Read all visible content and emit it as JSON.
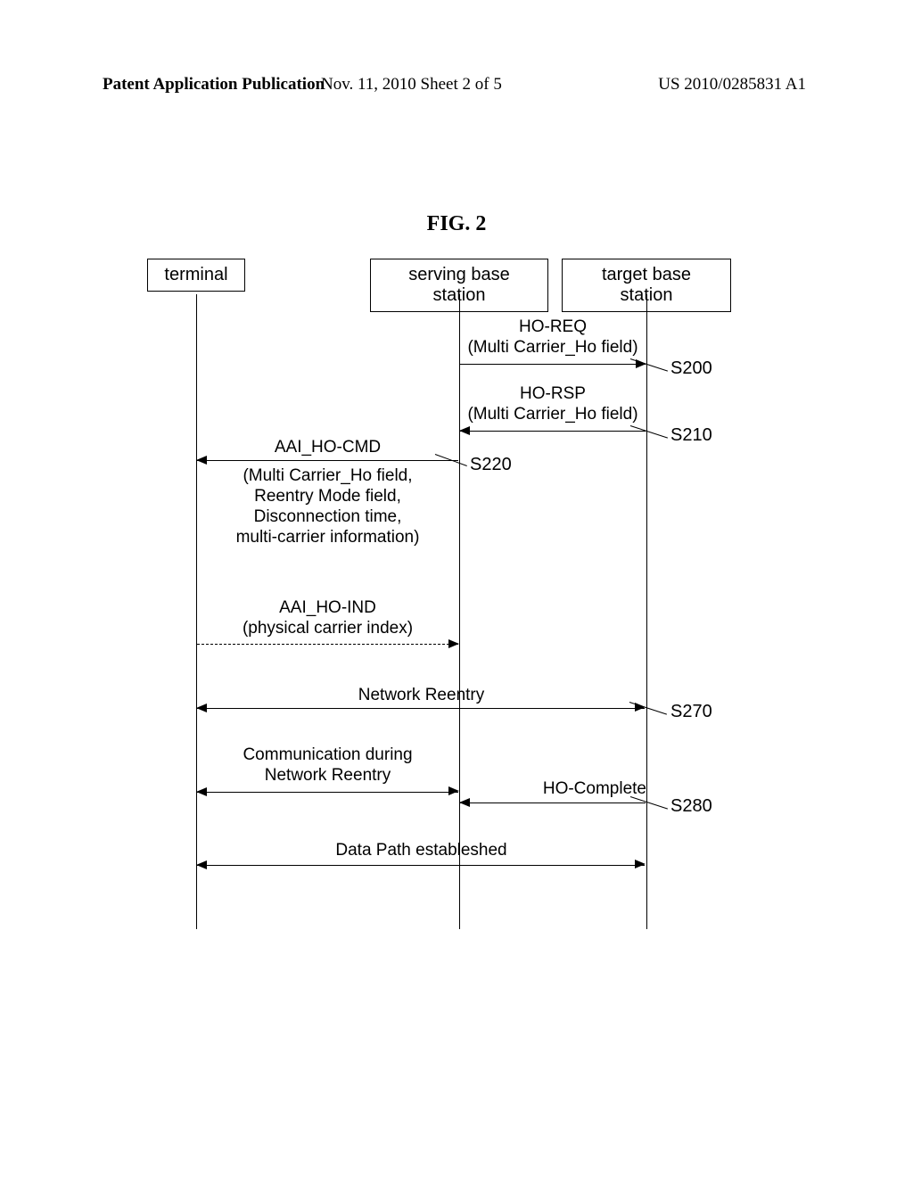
{
  "header": {
    "left": "Patent Application Publication",
    "mid": "Nov. 11, 2010   Sheet 2 of 5",
    "right": "US 2010/0285831 A1"
  },
  "figure_title": "FIG. 2",
  "actors": {
    "terminal": "terminal",
    "serving": "serving base station",
    "target": "target base station"
  },
  "msgs": {
    "ho_req_title": "HO-REQ",
    "ho_req_sub": "(Multi Carrier_Ho field)",
    "ho_rsp_title": "HO-RSP",
    "ho_rsp_sub": "(Multi Carrier_Ho field)",
    "cmd_title": "AAI_HO-CMD",
    "cmd_line1": "(Multi Carrier_Ho field,",
    "cmd_line2": "Reentry Mode field,",
    "cmd_line3": "Disconnection time,",
    "cmd_line4": "multi-carrier information)",
    "ind_title": "AAI_HO-IND",
    "ind_sub": "(physical carrier index)",
    "network_reentry": "Network Reentry",
    "comm_line1": "Communication during",
    "comm_line2": "Network Reentry",
    "ho_complete": "HO-Complete",
    "data_path": "Data Path estableshed"
  },
  "steps": {
    "s200": "S200",
    "s210": "S210",
    "s220": "S220",
    "s270": "S270",
    "s280": "S280"
  }
}
